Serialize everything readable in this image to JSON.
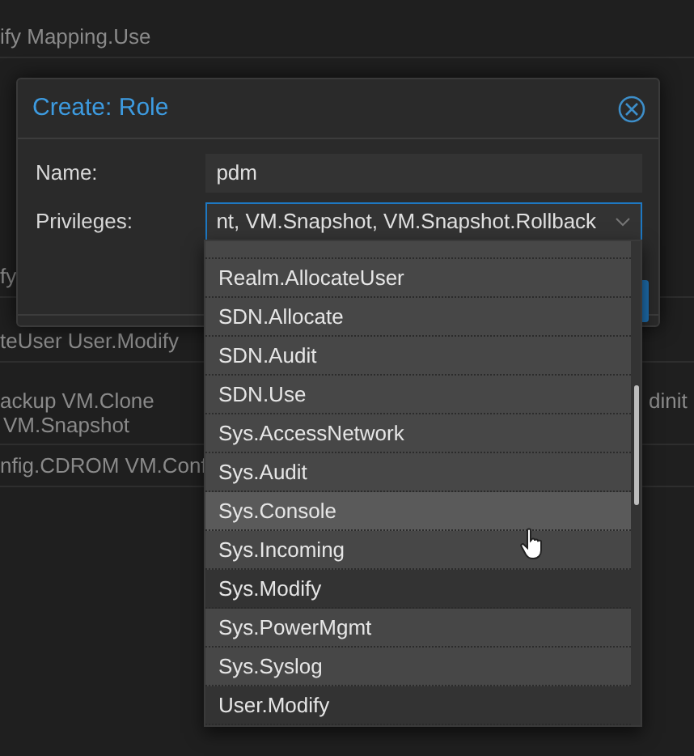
{
  "background_grid": {
    "rows": [
      {
        "column_1": "ify Mapping.Use"
      },
      {
        "column_1": "fy"
      },
      {
        "column_1": "teUser User.Modify"
      },
      {
        "column_1": "ackup VM.Clone",
        "column_1_line_2": "VM.Snapshot",
        "column_2": "dinit"
      },
      {
        "column_1": "nfig.CDROM VM.Conf"
      }
    ]
  },
  "dialog": {
    "title": "Create: Role",
    "fields": [
      {
        "kind": "text",
        "label": "Name:",
        "value": "pdm",
        "focused": false
      },
      {
        "kind": "combo",
        "label": "Privileges:",
        "value": "nt, VM.Snapshot, VM.Snapshot.Rollback",
        "focused": true
      }
    ]
  },
  "dropdown": {
    "items": [
      {
        "label": "Realm.AllocateUser",
        "selected": true,
        "hovered": false
      },
      {
        "label": "SDN.Allocate",
        "selected": true,
        "hovered": false
      },
      {
        "label": "SDN.Audit",
        "selected": true,
        "hovered": false
      },
      {
        "label": "SDN.Use",
        "selected": true,
        "hovered": false
      },
      {
        "label": "Sys.AccessNetwork",
        "selected": true,
        "hovered": false
      },
      {
        "label": "Sys.Audit",
        "selected": true,
        "hovered": false
      },
      {
        "label": "Sys.Console",
        "selected": true,
        "hovered": true
      },
      {
        "label": "Sys.Incoming",
        "selected": true,
        "hovered": false
      },
      {
        "label": "Sys.Modify",
        "selected": false,
        "hovered": false
      },
      {
        "label": "Sys.PowerMgmt",
        "selected": true,
        "hovered": false
      },
      {
        "label": "Sys.Syslog",
        "selected": true,
        "hovered": false
      },
      {
        "label": "User.Modify",
        "selected": false,
        "hovered": false
      }
    ]
  }
}
